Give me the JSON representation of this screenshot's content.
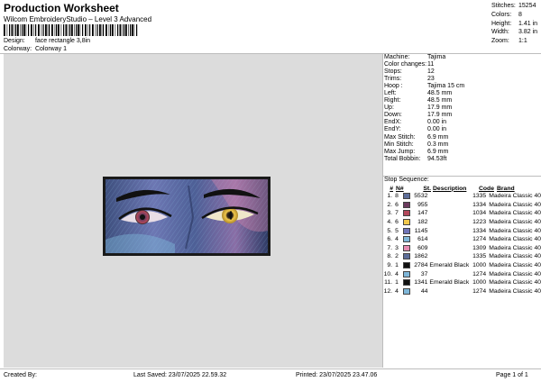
{
  "header": {
    "title": "Production Worksheet",
    "subtitle": "Wilcom EmbroideryStudio – Level 3 Advanced",
    "design_label": "Design:",
    "design_value": "face rectangle 3,8in",
    "colorway_label": "Colorway:",
    "colorway_value": "Colorway 1"
  },
  "stats": [
    {
      "label": "Stitches:",
      "value": "15254"
    },
    {
      "label": "Colors:",
      "value": "8"
    },
    {
      "label": "Height:",
      "value": "1.41 in"
    },
    {
      "label": "Width:",
      "value": "3.82 in"
    },
    {
      "label": "Zoom:",
      "value": "1:1"
    }
  ],
  "machine_info": [
    {
      "label": "Machine:",
      "value": "Tajima"
    },
    {
      "label": "Color changes:",
      "value": "11"
    },
    {
      "label": "Stops:",
      "value": "12"
    },
    {
      "label": "Trims:",
      "value": "23"
    },
    {
      "label": "Hoop :",
      "value": "Tajima 15 cm"
    },
    {
      "label": "Left:",
      "value": "48.5 mm"
    },
    {
      "label": "Right:",
      "value": "48.5 mm"
    },
    {
      "label": "Up:",
      "value": "17.9 mm"
    },
    {
      "label": "Down:",
      "value": "17.9 mm"
    },
    {
      "label": "EndX:",
      "value": "0.00 in"
    },
    {
      "label": "EndY:",
      "value": "0.00 in"
    },
    {
      "label": "Max Stitch:",
      "value": "6.9 mm"
    },
    {
      "label": "Min Stitch:",
      "value": "0.3 mm"
    },
    {
      "label": "Max Jump:",
      "value": "6.9 mm"
    },
    {
      "label": "Total Bobbin:",
      "value": "94.53ft"
    }
  ],
  "stop_sequence": {
    "title": "Stop Sequence:",
    "headers": {
      "num": "#",
      "n": "N#",
      "st": "St.",
      "desc": "Description",
      "code": "Code",
      "brand": "Brand"
    },
    "rows": [
      {
        "num": "1.",
        "n": "8",
        "color": "#5d6d99",
        "st": "5532",
        "desc": "",
        "code": "1335",
        "brand": "Madeira Classic 40"
      },
      {
        "num": "2.",
        "n": "6",
        "color": "#6b3b5e",
        "st": "955",
        "desc": "",
        "code": "1334",
        "brand": "Madeira Classic 40"
      },
      {
        "num": "3.",
        "n": "7",
        "color": "#b3485b",
        "st": "147",
        "desc": "",
        "code": "1034",
        "brand": "Madeira Classic 40"
      },
      {
        "num": "4.",
        "n": "6",
        "color": "#f2c94c",
        "st": "182",
        "desc": "",
        "code": "1223",
        "brand": "Madeira Classic 40"
      },
      {
        "num": "5.",
        "n": "5",
        "color": "#6f74b8",
        "st": "1145",
        "desc": "",
        "code": "1334",
        "brand": "Madeira Classic 40"
      },
      {
        "num": "6.",
        "n": "4",
        "color": "#7fb7d9",
        "st": "614",
        "desc": "",
        "code": "1274",
        "brand": "Madeira Classic 40"
      },
      {
        "num": "7.",
        "n": "3",
        "color": "#e58ab0",
        "st": "609",
        "desc": "",
        "code": "1309",
        "brand": "Madeira Classic 40"
      },
      {
        "num": "8.",
        "n": "2",
        "color": "#5d6d99",
        "st": "1862",
        "desc": "",
        "code": "1335",
        "brand": "Madeira Classic 40"
      },
      {
        "num": "9.",
        "n": "1",
        "color": "#111111",
        "st": "2784",
        "desc": "Emerald Black",
        "code": "1000",
        "brand": "Madeira Classic 40"
      },
      {
        "num": "10.",
        "n": "4",
        "color": "#7fb7d9",
        "st": "37",
        "desc": "",
        "code": "1274",
        "brand": "Madeira Classic 40"
      },
      {
        "num": "11.",
        "n": "1",
        "color": "#111111",
        "st": "1341",
        "desc": "Emerald Black",
        "code": "1000",
        "brand": "Madeira Classic 40"
      },
      {
        "num": "12.",
        "n": "4",
        "color": "#7fb7d9",
        "st": "44",
        "desc": "",
        "code": "1274",
        "brand": "Madeira Classic 40"
      }
    ]
  },
  "footer": {
    "created_by": "Created By:",
    "last_saved": "Last Saved: 23/07/2025 22.59.32",
    "printed": "Printed: 23/07/2025 23.47.06",
    "page": "Page 1 of 1"
  },
  "colors": {
    "canvas_bg": "#dcdcdc",
    "design_border": "#1a1a1a"
  }
}
